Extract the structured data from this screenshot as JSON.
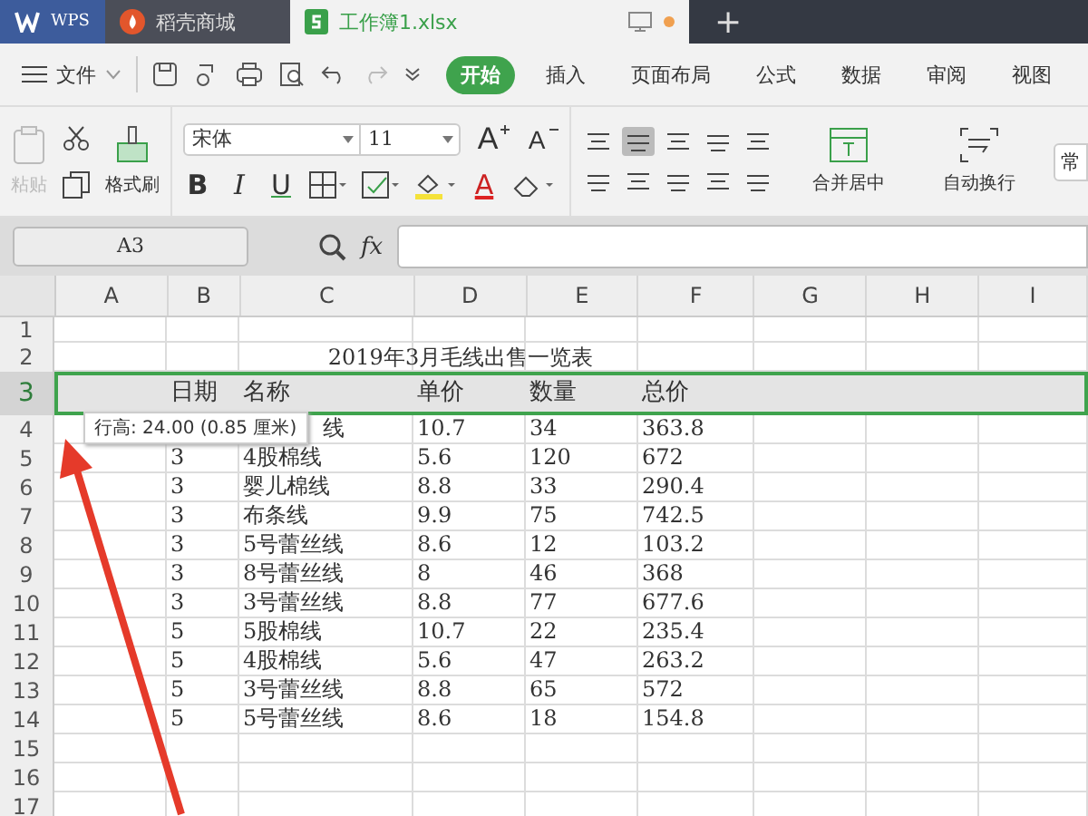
{
  "tabs": [
    {
      "label": "WPS",
      "kind": "app",
      "selected": false
    },
    {
      "label": "稻壳商城",
      "kind": "shop",
      "selected": false
    },
    {
      "label": "工作簿1.xlsx",
      "kind": "doc",
      "selected": true
    }
  ],
  "new_tab": "+",
  "menu": {
    "file": "文件",
    "items": [
      {
        "label": "开始",
        "selected": true
      },
      {
        "label": "插入",
        "selected": false
      },
      {
        "label": "页面布局",
        "selected": false
      },
      {
        "label": "公式",
        "selected": false
      },
      {
        "label": "数据",
        "selected": false
      },
      {
        "label": "审阅",
        "selected": false
      },
      {
        "label": "视图",
        "selected": false
      }
    ]
  },
  "ribbon": {
    "paste": {
      "label": "粘贴",
      "disabled": true
    },
    "format_painter": "格式刷",
    "font": "宋体",
    "size": "11",
    "grow": "A",
    "shrink": "A",
    "bold": "B",
    "italic": "I",
    "underline": "U",
    "font_color": "A",
    "merge": "合并居中",
    "wrap": "自动换行",
    "style_cut": "常"
  },
  "formula_bar": {
    "name_box": "A3",
    "fx": "fx"
  },
  "sheet": {
    "columns": [
      "A",
      "B",
      "C",
      "D",
      "E",
      "F",
      "G",
      "H",
      "I"
    ],
    "row_numbers": [
      {
        "label": "1",
        "selected": false
      },
      {
        "label": "2",
        "selected": false
      },
      {
        "label": "3",
        "selected": true
      },
      {
        "label": "4",
        "selected": false
      },
      {
        "label": "5",
        "selected": false
      },
      {
        "label": "6",
        "selected": false
      },
      {
        "label": "7",
        "selected": false
      },
      {
        "label": "8",
        "selected": false
      },
      {
        "label": "9",
        "selected": false
      },
      {
        "label": "10",
        "selected": false
      },
      {
        "label": "11",
        "selected": false
      },
      {
        "label": "12",
        "selected": false
      },
      {
        "label": "13",
        "selected": false
      },
      {
        "label": "14",
        "selected": false
      },
      {
        "label": "15",
        "selected": false
      },
      {
        "label": "16",
        "selected": false
      },
      {
        "label": "17",
        "selected": false
      }
    ],
    "title": "2019年3月毛线出售一览表",
    "header": [
      "日期",
      "名称",
      "单价",
      "数量",
      "总价"
    ],
    "rows": [
      {
        "cells": [
          "",
          "",
          "线",
          "10.7",
          "34",
          "363.8"
        ]
      },
      {
        "cells": [
          "",
          "3",
          "4股棉线",
          "5.6",
          "120",
          "672"
        ]
      },
      {
        "cells": [
          "",
          "3",
          "婴儿棉线",
          "8.8",
          "33",
          "290.4"
        ]
      },
      {
        "cells": [
          "",
          "3",
          "布条线",
          "9.9",
          "75",
          "742.5"
        ]
      },
      {
        "cells": [
          "",
          "3",
          "5号蕾丝线",
          "8.6",
          "12",
          "103.2"
        ]
      },
      {
        "cells": [
          "",
          "3",
          "8号蕾丝线",
          "8",
          "46",
          "368"
        ]
      },
      {
        "cells": [
          "",
          "3",
          "3号蕾丝线",
          "8.8",
          "77",
          "677.6"
        ]
      },
      {
        "cells": [
          "",
          "5",
          "5股棉线",
          "10.7",
          "22",
          "235.4"
        ]
      },
      {
        "cells": [
          "",
          "5",
          "4股棉线",
          "5.6",
          "47",
          "263.2"
        ]
      },
      {
        "cells": [
          "",
          "5",
          "3号蕾丝线",
          "8.8",
          "65",
          "572"
        ]
      },
      {
        "cells": [
          "",
          "5",
          "5号蕾丝线",
          "8.6",
          "18",
          "154.8"
        ]
      }
    ],
    "tooltip": "行高: 24.00 (0.85 厘米)"
  }
}
